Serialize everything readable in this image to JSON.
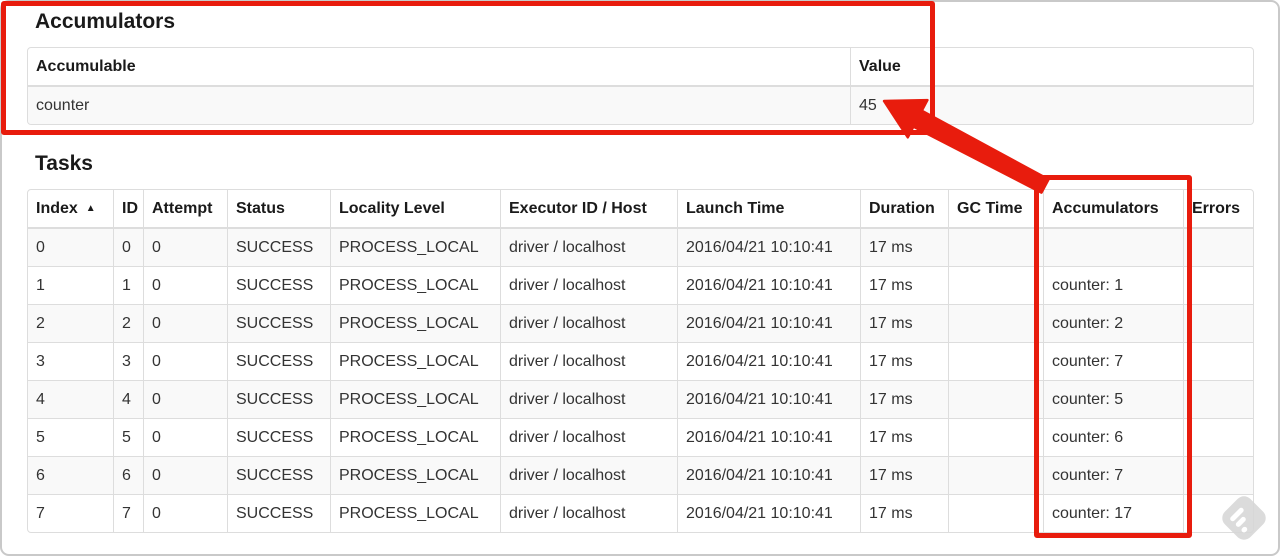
{
  "annotation": {
    "color": "#e81c0d",
    "highlights": [
      "box-around-accumulators-summary-table",
      "box-around-tasks-accumulators-column",
      "arrow-from-accumulators-column-to-total-value"
    ]
  },
  "accumulators": {
    "title": "Accumulators",
    "columns": [
      "Accumulable",
      "Value"
    ],
    "rows": [
      {
        "accumulable": "counter",
        "value": "45"
      }
    ]
  },
  "tasks": {
    "title": "Tasks",
    "sort_icon": "▲",
    "columns": [
      "Index",
      "ID",
      "Attempt",
      "Status",
      "Locality Level",
      "Executor ID / Host",
      "Launch Time",
      "Duration",
      "GC Time",
      "Accumulators",
      "Errors"
    ],
    "rows": [
      {
        "index": "0",
        "id": "0",
        "attempt": "0",
        "status": "SUCCESS",
        "locality_level": "PROCESS_LOCAL",
        "executor_id_host": "driver / localhost",
        "launch_time": "2016/04/21 10:10:41",
        "duration": "17 ms",
        "gc_time": "",
        "accumulators": "",
        "errors": ""
      },
      {
        "index": "1",
        "id": "1",
        "attempt": "0",
        "status": "SUCCESS",
        "locality_level": "PROCESS_LOCAL",
        "executor_id_host": "driver / localhost",
        "launch_time": "2016/04/21 10:10:41",
        "duration": "17 ms",
        "gc_time": "",
        "accumulators": "counter: 1",
        "errors": ""
      },
      {
        "index": "2",
        "id": "2",
        "attempt": "0",
        "status": "SUCCESS",
        "locality_level": "PROCESS_LOCAL",
        "executor_id_host": "driver / localhost",
        "launch_time": "2016/04/21 10:10:41",
        "duration": "17 ms",
        "gc_time": "",
        "accumulators": "counter: 2",
        "errors": ""
      },
      {
        "index": "3",
        "id": "3",
        "attempt": "0",
        "status": "SUCCESS",
        "locality_level": "PROCESS_LOCAL",
        "executor_id_host": "driver / localhost",
        "launch_time": "2016/04/21 10:10:41",
        "duration": "17 ms",
        "gc_time": "",
        "accumulators": "counter: 7",
        "errors": ""
      },
      {
        "index": "4",
        "id": "4",
        "attempt": "0",
        "status": "SUCCESS",
        "locality_level": "PROCESS_LOCAL",
        "executor_id_host": "driver / localhost",
        "launch_time": "2016/04/21 10:10:41",
        "duration": "17 ms",
        "gc_time": "",
        "accumulators": "counter: 5",
        "errors": ""
      },
      {
        "index": "5",
        "id": "5",
        "attempt": "0",
        "status": "SUCCESS",
        "locality_level": "PROCESS_LOCAL",
        "executor_id_host": "driver / localhost",
        "launch_time": "2016/04/21 10:10:41",
        "duration": "17 ms",
        "gc_time": "",
        "accumulators": "counter: 6",
        "errors": ""
      },
      {
        "index": "6",
        "id": "6",
        "attempt": "0",
        "status": "SUCCESS",
        "locality_level": "PROCESS_LOCAL",
        "executor_id_host": "driver / localhost",
        "launch_time": "2016/04/21 10:10:41",
        "duration": "17 ms",
        "gc_time": "",
        "accumulators": "counter: 7",
        "errors": ""
      },
      {
        "index": "7",
        "id": "7",
        "attempt": "0",
        "status": "SUCCESS",
        "locality_level": "PROCESS_LOCAL",
        "executor_id_host": "driver / localhost",
        "launch_time": "2016/04/21 10:10:41",
        "duration": "17 ms",
        "gc_time": "",
        "accumulators": "counter: 17",
        "errors": ""
      }
    ]
  }
}
